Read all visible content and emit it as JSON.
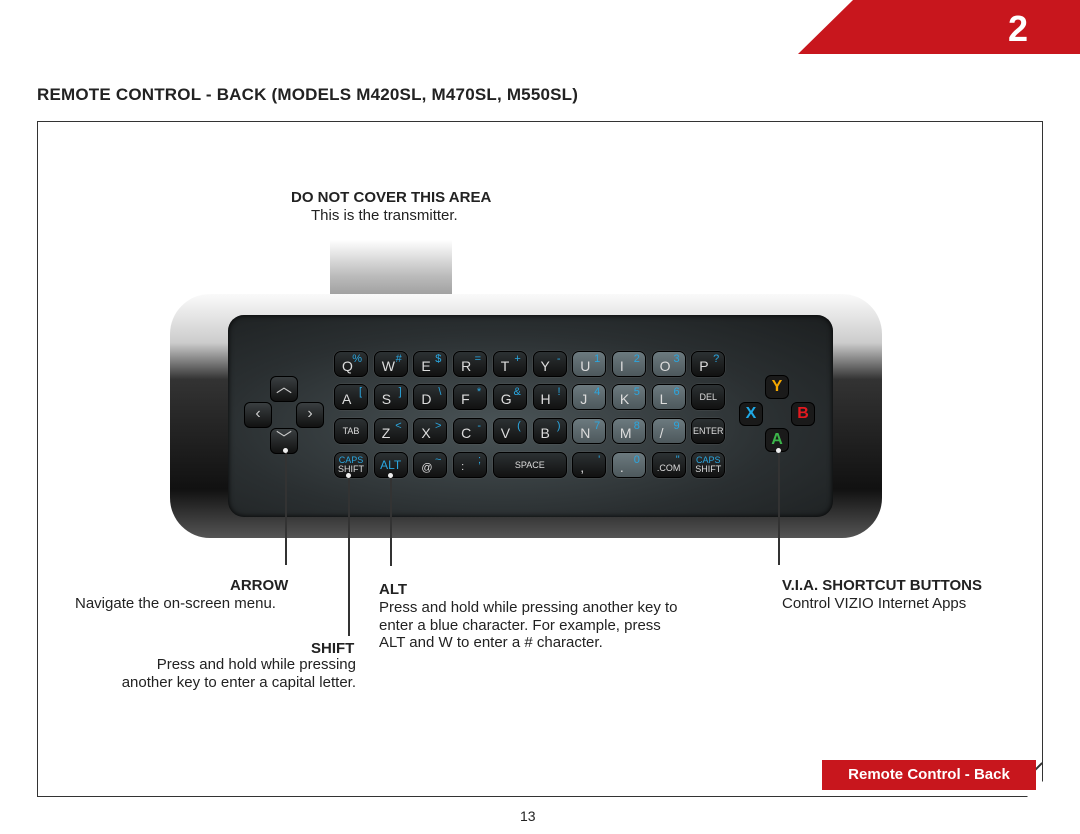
{
  "chapter": "2",
  "title": "REMOTE CONTROL - BACK (MODELS M420SL, M470SL, M550SL)",
  "transmitter": {
    "heading": "DO NOT COVER THIS AREA",
    "text": "This is the transmitter."
  },
  "keys": [
    [
      [
        "Q",
        "%"
      ],
      [
        "W",
        "#"
      ],
      [
        "E",
        "$"
      ],
      [
        "R",
        "="
      ],
      [
        "T",
        "+"
      ],
      [
        "Y",
        "-"
      ],
      [
        "U",
        "1",
        1
      ],
      [
        "I",
        "2",
        1
      ],
      [
        "O",
        "3",
        1
      ],
      [
        "P",
        "?"
      ]
    ],
    [
      [
        "A",
        "["
      ],
      [
        "S",
        "]"
      ],
      [
        "D",
        "\\"
      ],
      [
        "F",
        "*"
      ],
      [
        "G",
        "&"
      ],
      [
        "H",
        "!"
      ],
      [
        "J",
        "4",
        1
      ],
      [
        "K",
        "5",
        1
      ],
      [
        "L",
        "6",
        1
      ],
      [
        "DEL",
        ""
      ]
    ],
    [
      [
        "TAB",
        ""
      ],
      [
        "Z",
        "<"
      ],
      [
        "X",
        ">"
      ],
      [
        "C",
        "-"
      ],
      [
        "V",
        "("
      ],
      [
        "B",
        ")"
      ],
      [
        "N",
        "7",
        1
      ],
      [
        "M",
        "8",
        1
      ],
      [
        "/",
        "9",
        1
      ],
      [
        "ENTER",
        ""
      ]
    ]
  ],
  "bottom_row": {
    "caps_shift": [
      "CAPS",
      "SHIFT"
    ],
    "alt": "ALT",
    "at": [
      "@",
      "~"
    ],
    "colon": [
      ":",
      ";"
    ],
    "space": "SPACE",
    "comma": [
      ",",
      "'"
    ],
    "period": [
      ".",
      "0"
    ],
    "com": [
      ".COM",
      "\""
    ]
  },
  "gamepad": {
    "Y": "#f5a800",
    "X": "#1fa9e6",
    "B": "#e3191f",
    "A": "#3cb54a"
  },
  "callouts": {
    "arrow": {
      "heading": "ARROW",
      "text": "Navigate the on-screen menu."
    },
    "shift": {
      "heading": "SHIFT",
      "lines": [
        "Press and hold while pressing",
        "another key to enter a capital letter."
      ]
    },
    "alt": {
      "heading": "ALT",
      "lines": [
        "Press and hold while pressing another key to",
        "enter a blue character. For example, press",
        "ALT and W to enter a # character."
      ]
    },
    "via": {
      "heading": "V.I.A. SHORTCUT BUTTONS",
      "text": "Control VIZIO Internet Apps"
    }
  },
  "footer_button": "Remote Control - Back",
  "page_number": "13",
  "colors": {
    "brand_red": "#c8161d",
    "alt_blue": "#2aa7e0"
  }
}
